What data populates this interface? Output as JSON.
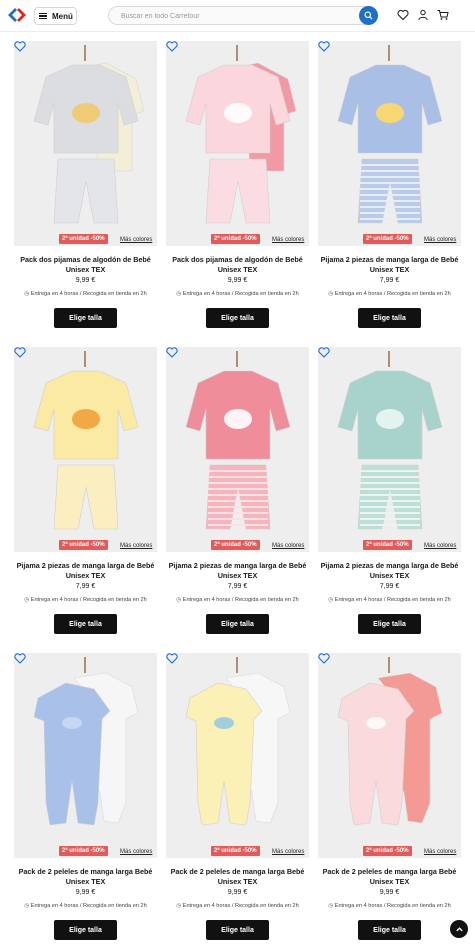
{
  "header": {
    "logo_icon": "carrefour-logo-icon",
    "menu_label": "Menú",
    "search_placeholder": "Buscar en todo Carrefour",
    "icons": [
      "search-icon",
      "heart-icon",
      "user-icon",
      "cart-icon"
    ]
  },
  "colors": {
    "brand_blue": "#1f6fc5",
    "promo_red": "#e15b5b",
    "button_black": "#111111"
  },
  "products": [
    {
      "title": "Pack dos pijamas de algodón de Bebé Unisex TEX",
      "price": "9,99 €",
      "promo": "2ª unidad -50%",
      "more_colors": "Más colores",
      "delivery": "Entrega en 4 horas / Recogida en tienda en 2h",
      "cta": "Elige talla",
      "image": "grey-yellow-pajama-pack"
    },
    {
      "title": "Pack dos pijamas de algodón de Bebé Unisex TEX",
      "price": "9,99 €",
      "promo": "2ª unidad -50%",
      "more_colors": "Más colores",
      "delivery": "Entrega en 4 horas / Recogida en tienda en 2h",
      "cta": "Elige talla",
      "image": "pink-pajama-pack"
    },
    {
      "title": "Pijama 2 piezas de manga larga de Bebé Unisex TEX",
      "price": "7,99 €",
      "promo": "2ª unidad -50%",
      "more_colors": "Más colores",
      "delivery": "Entrega en 4 horas / Recogida en tienda en 2h",
      "cta": "Elige talla",
      "image": "blue-pajama-striped"
    },
    {
      "title": "Pijama 2 piezas de manga larga de Bebé Unisex TEX",
      "price": "7,99 €",
      "promo": "2ª unidad -50%",
      "more_colors": "Más colores",
      "delivery": "Entrega en 4 horas / Recogida en tienda en 2h",
      "cta": "Elige talla",
      "image": "yellow-pajama-tiger"
    },
    {
      "title": "Pijama 2 piezas de manga larga de Bebé Unisex TEX",
      "price": "7,99 €",
      "promo": "2ª unidad -50%",
      "more_colors": "Más colores",
      "delivery": "Entrega en 4 horas / Recogida en tienda en 2h",
      "cta": "Elige talla",
      "image": "pink-pajama-rainbow"
    },
    {
      "title": "Pijama 2 piezas de manga larga de Bebé Unisex TEX",
      "price": "7,99 €",
      "promo": "2ª unidad -50%",
      "more_colors": "Más colores",
      "delivery": "Entrega en 4 horas / Recogida en tienda en 2h",
      "cta": "Elige talla",
      "image": "green-pajama-play"
    },
    {
      "title": "Pack de 2 peleles de manga larga Bebé Unisex TEX",
      "price": "9,99 €",
      "promo": "2ª unidad -50%",
      "more_colors": "Más colores",
      "delivery": "Entrega en 4 horas / Recogida en tienda en 2h",
      "cta": "Elige talla",
      "image": "blue-white-sleepsuit-pack"
    },
    {
      "title": "Pack de 2 peleles de manga larga Bebé Unisex TEX",
      "price": "9,99 €",
      "promo": "2ª unidad -50%",
      "more_colors": "Más colores",
      "delivery": "Entrega en 4 horas / Recogida en tienda en 2h",
      "cta": "Elige talla",
      "image": "yellow-sleepsuit-pack"
    },
    {
      "title": "Pack de 2 peleles de manga larga Bebé Unisex TEX",
      "price": "9,99 €",
      "promo": "2ª unidad -50%",
      "more_colors": "Más colores",
      "delivery": "Entrega en 4 horas / Recogida en tienda en 2h",
      "cta": "Elige talla",
      "image": "pink-sleepsuit-pack"
    }
  ]
}
